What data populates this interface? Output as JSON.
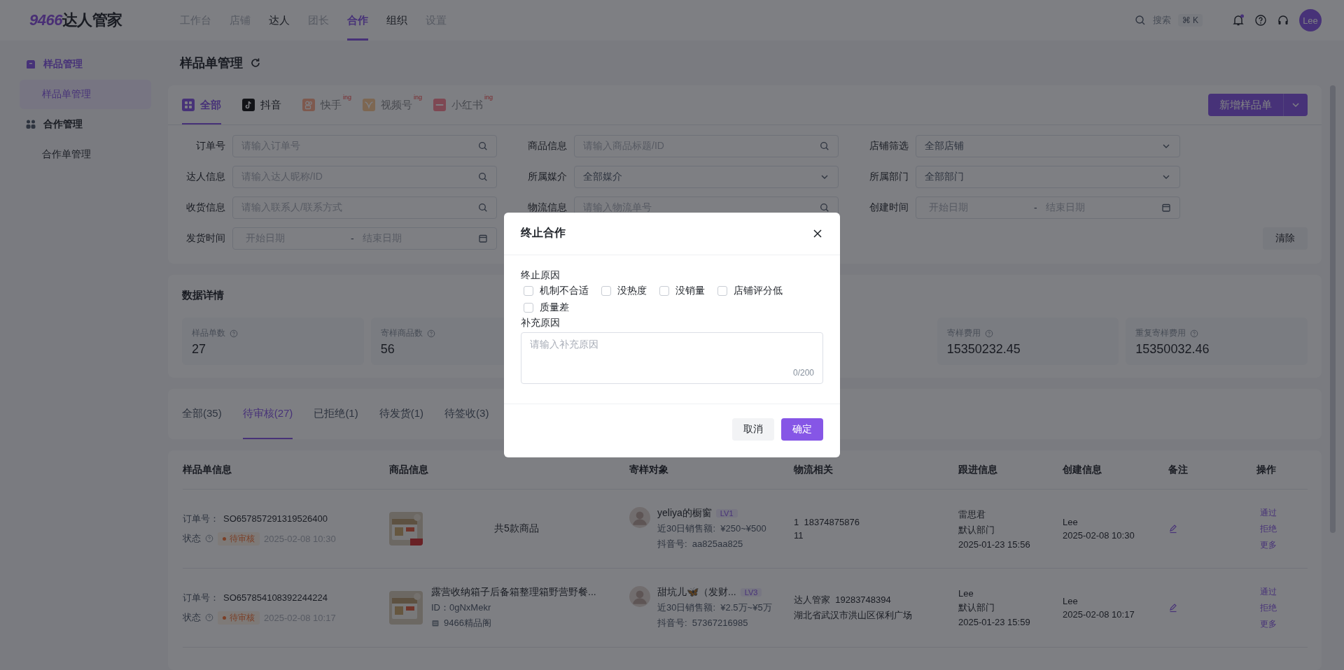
{
  "header": {
    "logo_mark": "9466",
    "logo_text": "达人管家",
    "nav": [
      {
        "label": "工作台",
        "selected": false,
        "disabled": true
      },
      {
        "label": "店铺",
        "selected": false,
        "disabled": true
      },
      {
        "label": "达人",
        "selected": false,
        "disabled": false
      },
      {
        "label": "团长",
        "selected": false,
        "disabled": true
      },
      {
        "label": "合作",
        "selected": true,
        "disabled": false
      },
      {
        "label": "组织",
        "selected": false,
        "disabled": false
      },
      {
        "label": "设置",
        "selected": false,
        "disabled": true
      }
    ],
    "search": {
      "placeholder": "搜索",
      "shortcut": "⌘ K"
    },
    "has_notification": true,
    "avatar": "Lee"
  },
  "sidebar": {
    "groups": [
      {
        "label": "样品管理",
        "kind": "box",
        "selected": true,
        "items": [
          {
            "label": "样品单管理",
            "selected": true
          }
        ]
      },
      {
        "label": "合作管理",
        "kind": "people",
        "selected": false,
        "items": [
          {
            "label": "合作单管理",
            "selected": false
          }
        ]
      }
    ]
  },
  "page_title": "样品单管理",
  "platform_tabs": [
    {
      "label": "全部",
      "kind": "all",
      "selected": true,
      "disabled": false
    },
    {
      "label": "抖音",
      "kind": "douyin",
      "selected": false,
      "disabled": false
    },
    {
      "label": "快手",
      "kind": "kuaishou",
      "selected": false,
      "disabled": true,
      "badge": "ing"
    },
    {
      "label": "视频号",
      "kind": "channels",
      "selected": false,
      "disabled": true,
      "badge": "ing"
    },
    {
      "label": "小红书",
      "kind": "xhs",
      "selected": false,
      "disabled": true,
      "badge": "ing"
    }
  ],
  "create_button": "新增样品单",
  "filters": [
    {
      "label": "订单号",
      "kind": "search",
      "placeholder": "请输入订单号"
    },
    {
      "label": "商品信息",
      "kind": "search",
      "placeholder": "请输入商品标题/ID"
    },
    {
      "label": "店铺筛选",
      "kind": "select",
      "value": "全部店铺"
    },
    {
      "label": "达人信息",
      "kind": "search",
      "placeholder": "请输入达人昵称/ID"
    },
    {
      "label": "所属媒介",
      "kind": "select",
      "value": "全部媒介"
    },
    {
      "label": "所属部门",
      "kind": "select",
      "value": "全部部门"
    },
    {
      "label": "收货信息",
      "kind": "search",
      "placeholder": "请输入联系人/联系方式"
    },
    {
      "label": "物流信息",
      "kind": "search",
      "placeholder": "请输入物流单号"
    },
    {
      "label": "创建时间",
      "kind": "daterange",
      "start_placeholder": "开始日期",
      "end_placeholder": "结束日期",
      "separator": "-"
    },
    {
      "label": "发货时间",
      "kind": "daterange",
      "start_placeholder": "开始日期",
      "end_placeholder": "结束日期",
      "separator": "-"
    }
  ],
  "clear_button": "清除",
  "stats": {
    "title": "数据详情",
    "cards": [
      {
        "label": "样品单数",
        "value": "27"
      },
      {
        "label": "寄样商品数",
        "value": "56"
      },
      {
        "label": "寄样费用",
        "value": "15350232.45"
      },
      {
        "label": "重复寄样费用",
        "value": "15350032.46"
      }
    ]
  },
  "status_tabs": [
    {
      "label": "全部(35)",
      "selected": false
    },
    {
      "label": "待审核(27)",
      "selected": true
    },
    {
      "label": "已拒绝(1)",
      "selected": false
    },
    {
      "label": "待发货(1)",
      "selected": false
    },
    {
      "label": "待签收(3)",
      "selected": false
    }
  ],
  "table": {
    "columns": [
      "样品单信息",
      "商品信息",
      "寄样对象",
      "物流相关",
      "跟进信息",
      "创建信息",
      "备注",
      "操作"
    ],
    "rows": [
      {
        "order_label": "订单号：",
        "order_no": "SO657857291319526400",
        "status_label": "状态",
        "status": "待审核",
        "status_time": "2025-02-08 10:30",
        "product": {
          "kind": "multi",
          "summary": "共5款商品"
        },
        "creator": {
          "name": "yeliya的橱窗",
          "level": "LV1",
          "sales_label": "近30日销售额:",
          "sales": "¥250~¥500",
          "account_label": "抖音号:",
          "account": "aa825aa825"
        },
        "logistics": [
          "1  18374875876",
          "11"
        ],
        "follow_up": [
          "雷思君",
          "默认部门",
          "2025-01-23 15:56"
        ],
        "created": [
          "Lee",
          "2025-02-08 10:30"
        ],
        "actions": [
          "通过",
          "拒绝",
          "更多"
        ]
      },
      {
        "order_label": "订单号：",
        "order_no": "SO657854108392244224",
        "status_label": "状态",
        "status": "待审核",
        "status_time": "2025-02-08 10:17",
        "product": {
          "kind": "single",
          "title": "露营收纳箱子后备箱整理箱野营野餐...",
          "id": "ID：0gNxMekr",
          "store": "9466精品阁"
        },
        "creator": {
          "name": "甜坑儿🦋（发财...",
          "level": "LV3",
          "sales_label": "近30日销售额:",
          "sales": "¥2.5万~¥5万",
          "account_label": "抖音号:",
          "account": "57367216985"
        },
        "logistics": [
          "达人管家  19283748394",
          "湖北省武汉市洪山区保利广场"
        ],
        "follow_up": [
          "Lee",
          "默认部门",
          "2025-01-23 15:59"
        ],
        "created": [
          "Lee",
          "2025-02-08 10:17"
        ],
        "actions": [
          "通过",
          "拒绝",
          "更多"
        ]
      }
    ]
  },
  "dialog": {
    "title": "终止合作",
    "reason_label": "终止原因",
    "reasons": [
      {
        "label": "机制不合适",
        "checked": false
      },
      {
        "label": "没热度",
        "checked": false
      },
      {
        "label": "没销量",
        "checked": false
      },
      {
        "label": "店铺评分低",
        "checked": false
      },
      {
        "label": "质量差",
        "checked": false
      }
    ],
    "note_label": "补充原因",
    "note_placeholder": "请输入补充原因",
    "counter": "0/200",
    "cancel": "取消",
    "confirm": "确定"
  }
}
